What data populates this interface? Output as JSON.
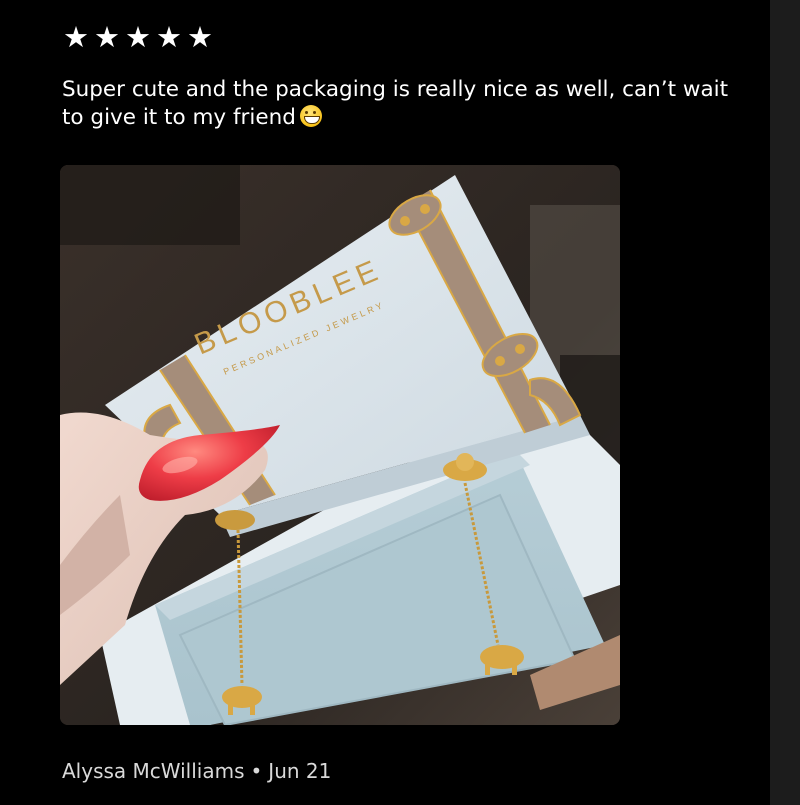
{
  "review": {
    "rating": 5,
    "rating_max": 5,
    "star_glyph": "★",
    "text": "Super cute and the packaging is really nice as well, can’t wait to give it to my friend",
    "emoji_name": "grinning-face-emoji",
    "author": "Alyssa McWilliams",
    "separator": "•",
    "date": "Jun 21"
  },
  "photo": {
    "brand": "BLOOBLEE",
    "tagline": "PERSONALIZED JEWELRY"
  },
  "colors": {
    "background": "#000000",
    "text": "#ffffff",
    "meta_text": "#d9d9d9",
    "box_blue": "#d7e3ea",
    "strap_taupe": "#a58d7a",
    "gold": "#d9a845",
    "nail_red": "#e8343f"
  }
}
